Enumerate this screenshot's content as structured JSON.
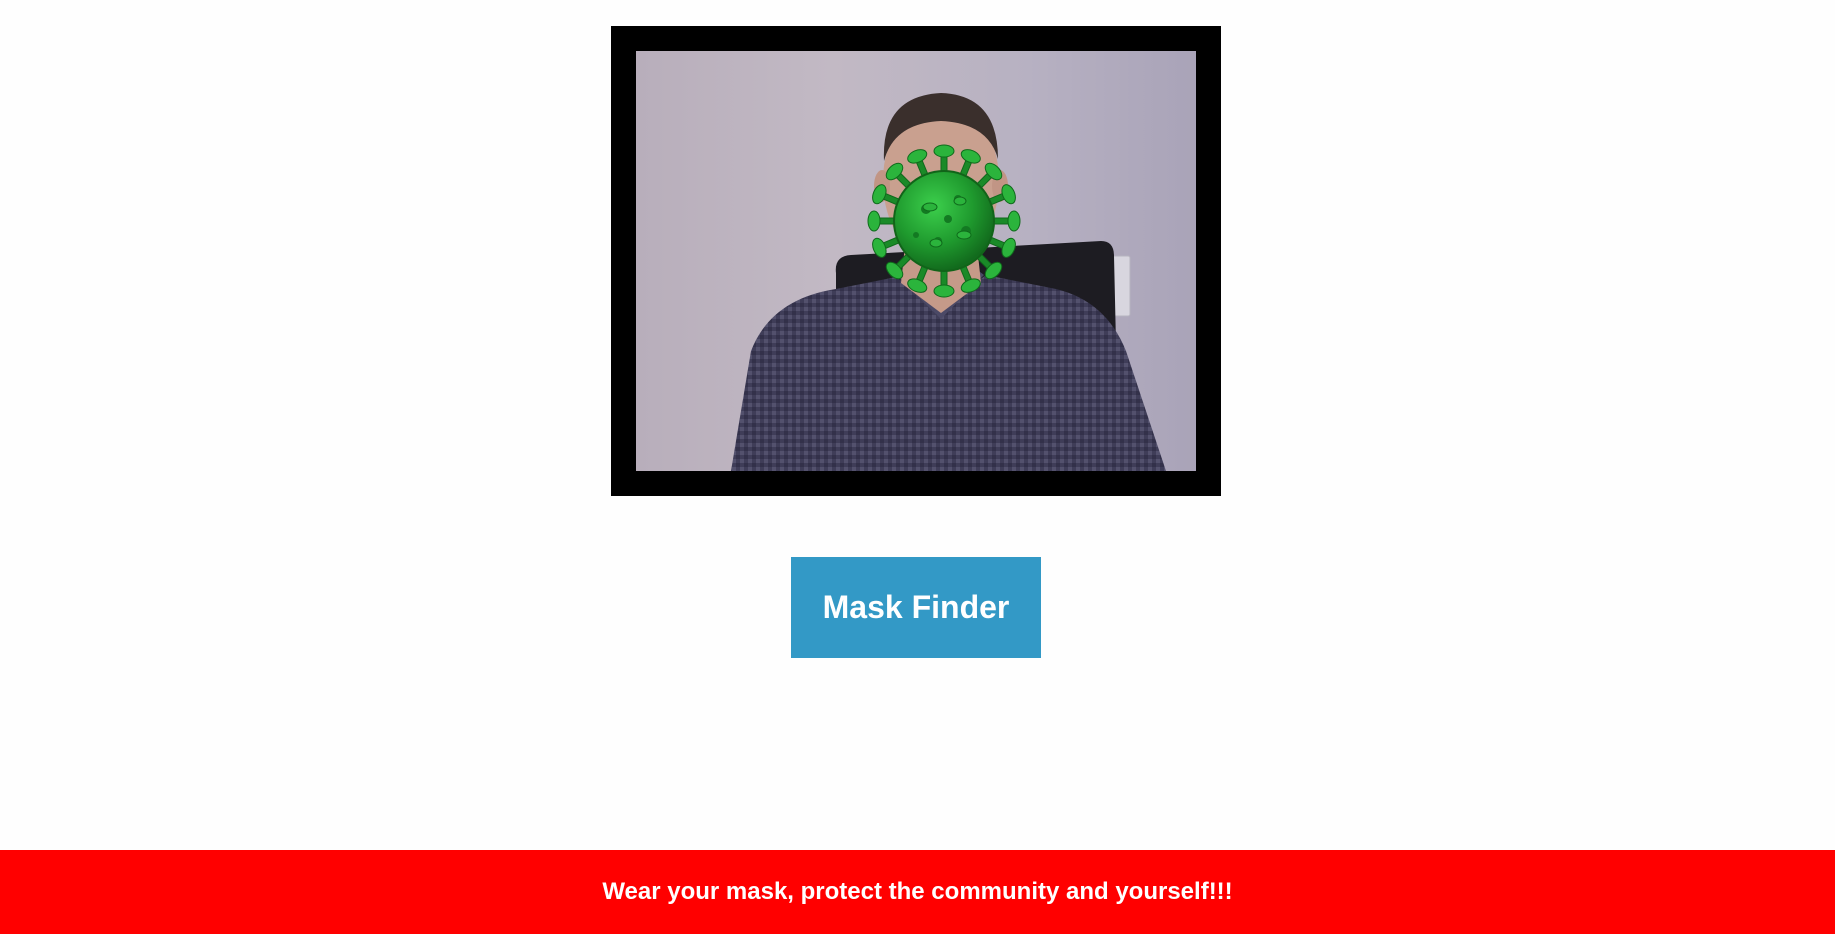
{
  "camera": {
    "overlay_icon": "virus-icon",
    "overlay_color": "#1f9a2e"
  },
  "button": {
    "label": "Mask Finder",
    "color": "#3399c6"
  },
  "footer": {
    "message": "Wear your mask, protect the community and yourself!!!",
    "color": "#ff0000"
  }
}
